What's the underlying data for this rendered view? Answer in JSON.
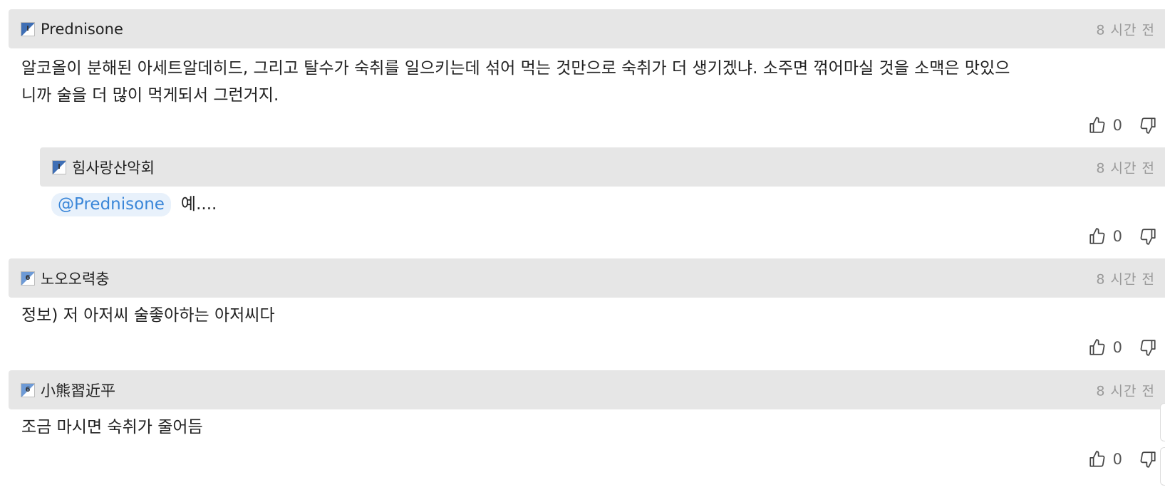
{
  "comments": [
    {
      "author": "Prednisone",
      "level": "I",
      "time": "8 시간 전",
      "line1": "알코올이 분해된 아세트알데히드, 그리고 탈수가 숙취를 일으키는데 섞어 먹는 것만으로 숙취가 더 생기겠냐. 소주면 꺾어마실 것을 소맥은 맛있으",
      "line2": "니까 술을 더 많이 먹게되서 그런거지.",
      "likes": "0"
    },
    {
      "author": "힘사랑산악회",
      "level": "I",
      "time": "8 시간 전",
      "mention": "@Prednisone",
      "text": "예....",
      "likes": "0"
    },
    {
      "author": "노오오력충",
      "level": "6",
      "time": "8 시간 전",
      "text": "정보) 저 아저씨 술좋아하는 아저씨다",
      "likes": "0"
    },
    {
      "author": "小熊習近平",
      "level": "6",
      "time": "8 시간 전",
      "text": "조금 마시면 숙취가 줄어듬",
      "likes": "0"
    }
  ],
  "icons": {
    "like": "thumbs-up-icon",
    "dislike": "thumbs-down-icon"
  },
  "colors": {
    "header_bg": "#e6e6e6",
    "mention_bg": "#e8f1fb",
    "mention_text": "#3a86d8",
    "time_text": "#999999"
  }
}
